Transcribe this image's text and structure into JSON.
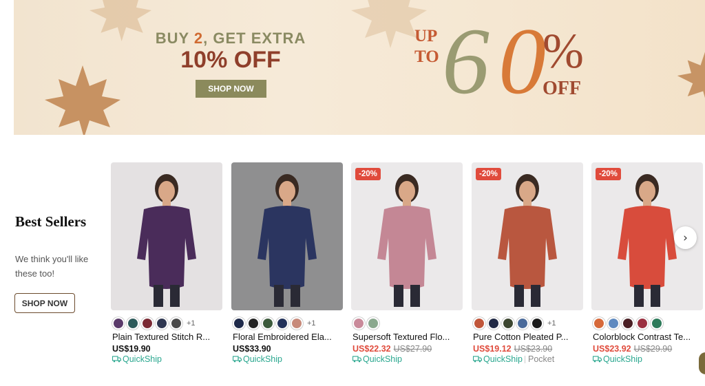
{
  "banner": {
    "line1_prefix": "BUY ",
    "line1_num": "2",
    "line1_suffix": ", GET EXTRA",
    "line2": "10% OFF",
    "button": "SHOP NOW",
    "up": "UP",
    "to": "TO",
    "six": "6",
    "zero": "0",
    "percent": "%",
    "off": "OFF"
  },
  "best_sellers": {
    "title": "Best Sellers",
    "subtitle": "We think you'll like these too!",
    "button": "SHOP NOW"
  },
  "products": [
    {
      "name": "Plain Textured Stitch R...",
      "price": "US$19.90",
      "original_price": "",
      "discount": "",
      "shipping": "QuickShip",
      "tag": "",
      "swatches": [
        "#5a3a6a",
        "#2d5a5a",
        "#7a2a34",
        "#2e3650",
        "#4a4a4a"
      ],
      "more": "+1",
      "image_bg": "#e4e1e2",
      "garment": "#4a2c5a"
    },
    {
      "name": "Floral Embroidered Ela...",
      "price": "US$33.90",
      "original_price": "",
      "discount": "",
      "shipping": "QuickShip",
      "tag": "",
      "swatches": [
        "#1f2a4a",
        "#222222",
        "#3c5a3c",
        "#23325a",
        "#c78a7a"
      ],
      "more": "+1",
      "image_bg": "#8f8f90",
      "garment": "#2b3560"
    },
    {
      "name": "Supersoft Textured Flo...",
      "price": "US$22.32",
      "original_price": "US$27.90",
      "discount": "-20%",
      "shipping": "QuickShip",
      "tag": "",
      "swatches": [
        "#c98a9a",
        "#8aa88e"
      ],
      "more": "",
      "image_bg": "#ebe9ea",
      "garment": "#c48795"
    },
    {
      "name": "Pure Cotton Pleated P...",
      "price": "US$19.12",
      "original_price": "US$23.90",
      "discount": "-20%",
      "shipping": "QuickShip",
      "tag": "Pocket",
      "swatches": [
        "#c0563a",
        "#202844",
        "#3c4630",
        "#4a6a9a",
        "#1a1a1a"
      ],
      "more": "+1",
      "image_bg": "#ebe9ea",
      "garment": "#b9573f"
    },
    {
      "name": "Colorblock Contrast Te...",
      "price": "US$23.92",
      "original_price": "US$29.90",
      "discount": "-20%",
      "shipping": "QuickShip",
      "tag": "",
      "swatches": [
        "#d6693a",
        "#5f8ac0",
        "#4a1f24",
        "#9a3040",
        "#2d7a5a"
      ],
      "more": "",
      "image_bg": "#ebe9ea",
      "garment": "#d84c3c"
    }
  ],
  "next_icon": "chevron-right-icon",
  "accent_green": "#2aa78f",
  "sale_red": "#e04b3c"
}
